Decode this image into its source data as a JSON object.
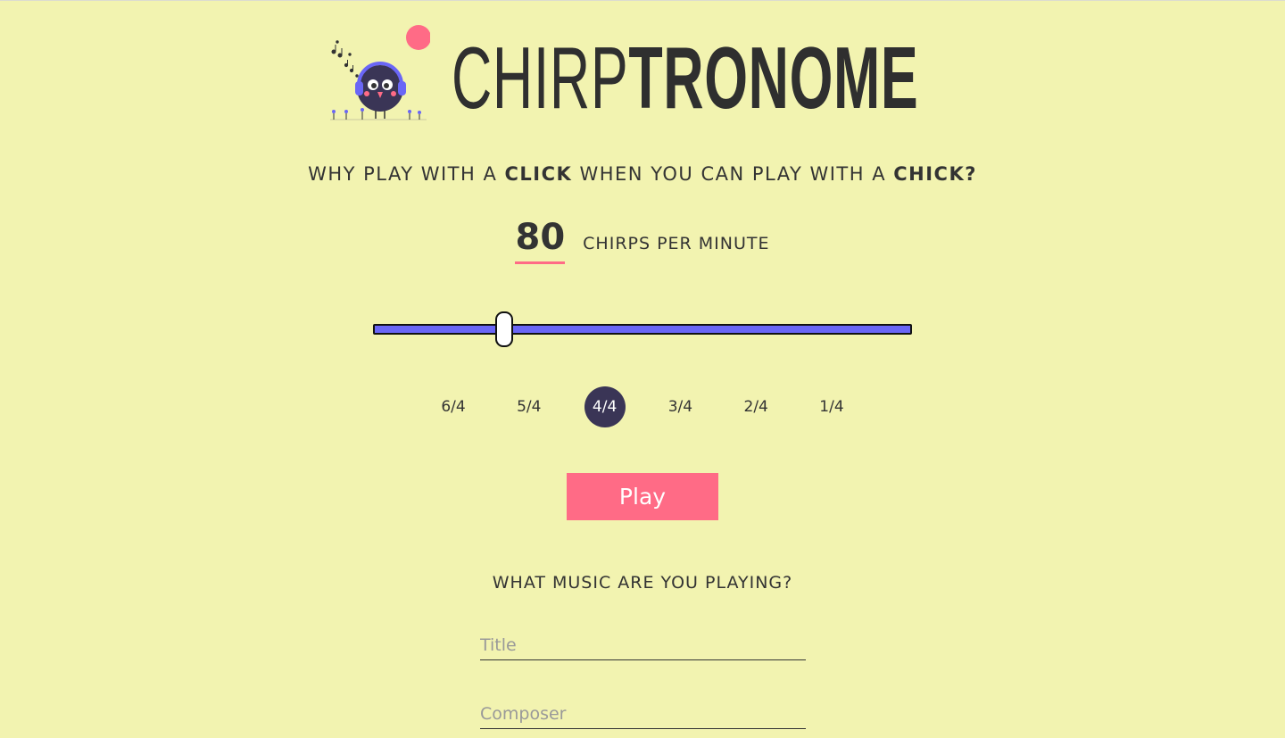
{
  "header": {
    "logo_light": "CHIRP",
    "logo_bold": "TRONOME",
    "mascot_icon": "headphone-bird-icon"
  },
  "tagline": {
    "part1": "WHY PLAY WITH A ",
    "strong1": "CLICK",
    "part2": " WHEN YOU CAN PLAY WITH A ",
    "strong2": "CHICK?"
  },
  "tempo": {
    "value": "80",
    "unit_label": "CHIRPS PER MINUTE",
    "slider_fraction": 0.245
  },
  "time_signatures": {
    "options": [
      "6/4",
      "5/4",
      "4/4",
      "3/4",
      "2/4",
      "1/4"
    ],
    "selected": "4/4"
  },
  "play_button": {
    "label": "Play"
  },
  "music": {
    "heading": "WHAT MUSIC ARE YOU PLAYING?",
    "title_placeholder": "Title",
    "title_value": "",
    "composer_placeholder": "Composer",
    "composer_value": ""
  },
  "colors": {
    "background": "#f2f3b0",
    "accent": "#ff6b86",
    "slider": "#6a66f6",
    "selected": "#3a3556"
  }
}
